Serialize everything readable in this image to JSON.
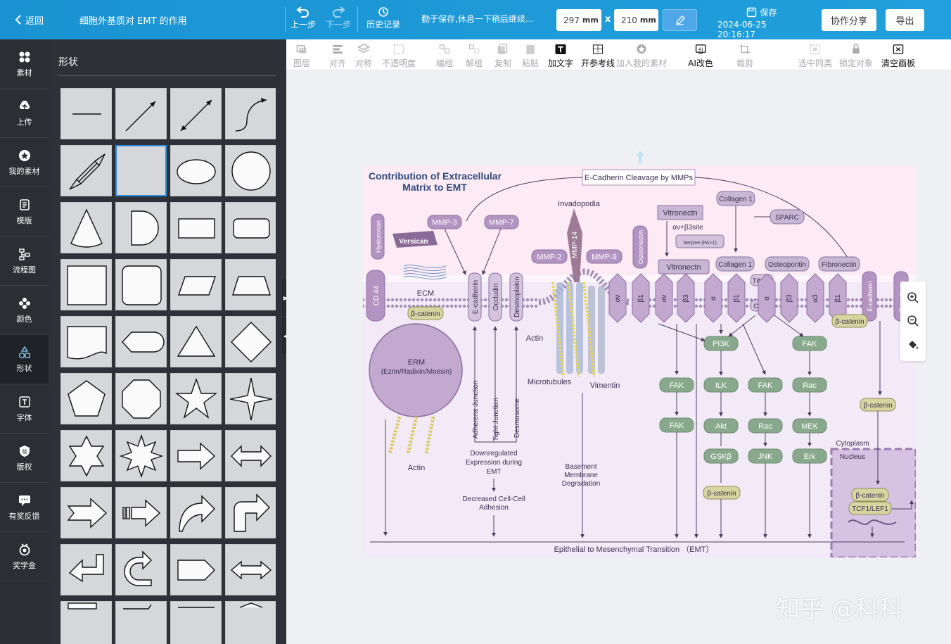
{
  "topbar": {
    "back_label": "返回",
    "doc_title": "细胞外基质对 EMT 的作用",
    "undo_label": "上一步",
    "redo_label": "下一步",
    "history_label": "历史记录",
    "autosave_hint": "勤于保存,休息一下稍后继续...",
    "width_value": "297",
    "height_value": "210",
    "unit": "mm",
    "times": "x",
    "save_label": "保存",
    "save_time": "2024-06-25 20:16:17",
    "share_label": "协作分享",
    "export_label": "导出"
  },
  "leftnav": [
    {
      "label": "素材",
      "icon": "grid-icon"
    },
    {
      "label": "上传",
      "icon": "upload-icon"
    },
    {
      "label": "我的素材",
      "icon": "star-icon"
    },
    {
      "label": "模版",
      "icon": "template-icon"
    },
    {
      "label": "流程图",
      "icon": "flowchart-icon"
    },
    {
      "label": "颜色",
      "icon": "palette-icon"
    },
    {
      "label": "形状",
      "icon": "shapes-icon"
    },
    {
      "label": "字体",
      "icon": "text-icon"
    },
    {
      "label": "版权",
      "icon": "copyright-icon"
    },
    {
      "label": "有奖反馈",
      "icon": "feedback-icon"
    },
    {
      "label": "奖学金",
      "icon": "scholarship-icon"
    }
  ],
  "shapes_panel": {
    "title": "形状"
  },
  "toolbar2": [
    {
      "label": "图层",
      "enabled": false
    },
    {
      "label": "对齐",
      "enabled": false
    },
    {
      "label": "对称",
      "enabled": false
    },
    {
      "label": "不透明度",
      "enabled": false
    },
    {
      "label": "编组",
      "enabled": false
    },
    {
      "label": "解组",
      "enabled": false
    },
    {
      "label": "复制",
      "enabled": false
    },
    {
      "label": "粘贴",
      "enabled": false
    },
    {
      "label": "加文字",
      "enabled": true
    },
    {
      "label": "开参考线",
      "enabled": true
    },
    {
      "label": "加入我的素材",
      "enabled": false
    },
    {
      "label": "AI改色",
      "enabled": true
    },
    {
      "label": "裁剪",
      "enabled": false
    },
    {
      "label": "选中同类",
      "enabled": false
    },
    {
      "label": "锁定对象",
      "enabled": false
    },
    {
      "label": "清空画板",
      "enabled": true
    }
  ],
  "diagram": {
    "title_line1": "Contribution of Extracellular",
    "title_line2": "Matrix to EMT",
    "cleavage": "E-Cadherin Cleavage by MMPs",
    "invadopodia": "Invadopodia",
    "mmp3": "MMP-3",
    "mmp7": "MMP-7",
    "mmp2": "MMP-2",
    "mmp14": "MMP-14",
    "mmp9": "MMP-9",
    "hyaluronan": "Hyaluronan",
    "versican": "Versican",
    "ecm": "ECM",
    "cd44": "CD 44",
    "beta_catenin": "β-catenin",
    "erm": "ERM",
    "erm_full": "(Ezrin/Radixin/Moesin)",
    "actin": "Actin",
    "microtubules": "Microtubules",
    "vimentin": "Vimentin",
    "e_cadherin": "E-cadherin",
    "occludin": "Occludin",
    "desmoplakin": "Desmoplakin",
    "adherens": "Adherens Junction",
    "tight": "Tight Junction",
    "desmosome": "Desmosome",
    "downregulated_1": "Downregulated",
    "downregulated_2": "Expression during",
    "downregulated_3": "EMT",
    "decreased_1": "Decreased Cell-Cell",
    "decreased_2": "Adhesion",
    "basement_1": "Basement",
    "basement_2": "Membrane",
    "basement_3": "Degradation",
    "osteonectin": "Osteonectin",
    "vitronectin_top": "Vitronectn",
    "vitronectin": "Vitronectn",
    "serpine": "Serpine (PAI-1)",
    "integrin_site": "αv+β3site",
    "collagen1_top": "Collagen 1",
    "collagen1": "Collagen 1",
    "sparc": "SPARC",
    "osteopontin": "Osteopontin",
    "fibronectin": "Fibronectin",
    "timp1": "TIMP1",
    "cd63": "CD63",
    "integrins": [
      "αv",
      "β1",
      "αv",
      "β3",
      "α",
      "β1",
      "α",
      "β3",
      "α3",
      "β1"
    ],
    "pi3k": "PI3K",
    "fak": "FAK",
    "ilk": "ILK",
    "rac": "Rac",
    "akt": "Akt",
    "mek": "MEK",
    "gsk3b": "GSKβ",
    "jnk": "JNK",
    "erk": "Erk",
    "cytoplasm": "Cytoplasm",
    "nucleus": "Nucleus",
    "tcf": "TCF1/LEF1",
    "emt_label": "Epithelial to Mesenchymal Transition （EMT）"
  },
  "watermark": "知乎 @科科"
}
